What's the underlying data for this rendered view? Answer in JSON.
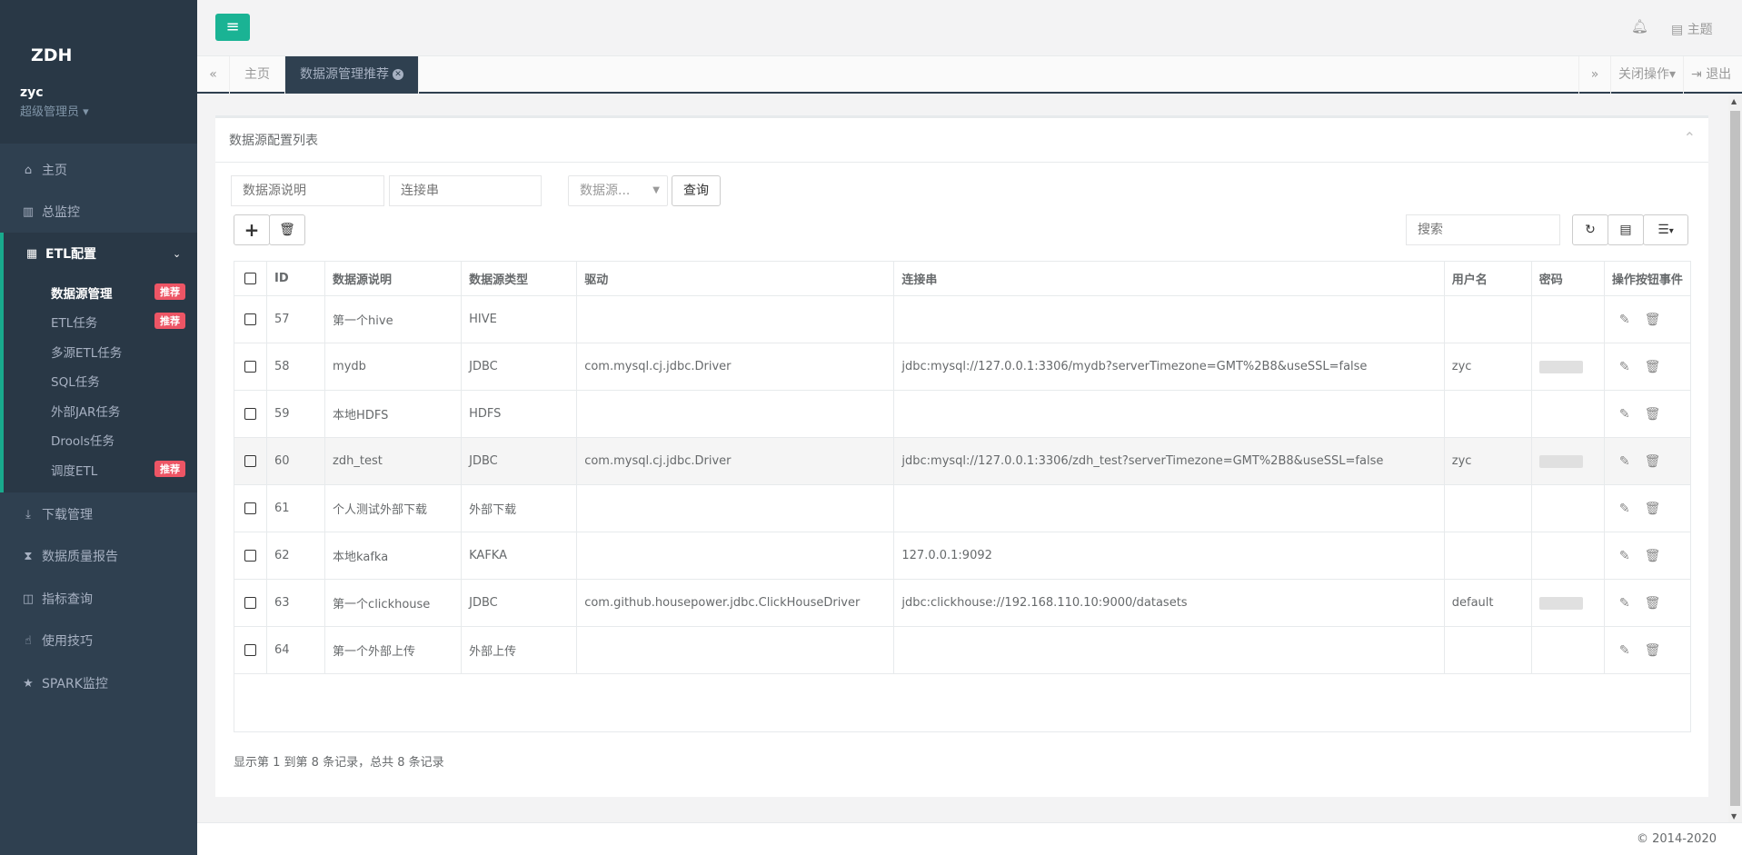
{
  "sidebar": {
    "logo": "ZDH",
    "user": "zyc",
    "role": "超级管理员",
    "nav": {
      "home": "主页",
      "monitor": "总监控",
      "etl": "ETL配置",
      "download": "下载管理",
      "quality": "数据质量报告",
      "metrics": "指标查询",
      "tips": "使用技巧",
      "spark": "SPARK监控"
    },
    "sub": [
      "数据源管理",
      "ETL任务",
      "多源ETL任务",
      "SQL任务",
      "外部JAR任务",
      "Drools任务",
      "调度ETL"
    ],
    "badge": "推荐"
  },
  "topbar": {
    "theme": "主题"
  },
  "tabs": {
    "home": "主页",
    "active": "数据源管理推荐",
    "close_ops": "关闭操作",
    "logout": "退出"
  },
  "panel": {
    "title": "数据源配置列表",
    "filter_desc_placeholder": "数据源说明",
    "filter_url_placeholder": "连接串",
    "filter_type": "数据源...",
    "query_btn": "查询",
    "search_placeholder": "搜索"
  },
  "table": {
    "headers": [
      "ID",
      "数据源说明",
      "数据源类型",
      "驱动",
      "连接串",
      "用户名",
      "密码",
      "操作按钮事件"
    ],
    "rows": [
      {
        "id": "57",
        "desc": "第一个hive",
        "type": "HIVE",
        "driver": "",
        "url": "",
        "user": ""
      },
      {
        "id": "58",
        "desc": "mydb",
        "type": "JDBC",
        "driver": "com.mysql.cj.jdbc.Driver",
        "url": "jdbc:mysql://127.0.0.1:3306/mydb?serverTimezone=GMT%2B8&useSSL=false",
        "user": "zyc"
      },
      {
        "id": "59",
        "desc": "本地HDFS",
        "type": "HDFS",
        "driver": "",
        "url": "",
        "user": ""
      },
      {
        "id": "60",
        "desc": "zdh_test",
        "type": "JDBC",
        "driver": "com.mysql.cj.jdbc.Driver",
        "url": "jdbc:mysql://127.0.0.1:3306/zdh_test?serverTimezone=GMT%2B8&useSSL=false",
        "user": "zyc"
      },
      {
        "id": "61",
        "desc": "个人测试外部下载",
        "type": "外部下载",
        "driver": "",
        "url": "",
        "user": ""
      },
      {
        "id": "62",
        "desc": "本地kafka",
        "type": "KAFKA",
        "driver": "",
        "url": "127.0.0.1:9092",
        "user": ""
      },
      {
        "id": "63",
        "desc": "第一个clickhouse",
        "type": "JDBC",
        "driver": "com.github.housepower.jdbc.ClickHouseDriver",
        "url": "jdbc:clickhouse://192.168.110.10:9000/datasets",
        "user": "default"
      },
      {
        "id": "64",
        "desc": "第一个外部上传",
        "type": "外部上传",
        "driver": "",
        "url": "",
        "user": ""
      }
    ]
  },
  "pagination": {
    "info": "显示第 1 到第 8 条记录，总共 8 条记录"
  },
  "footer": {
    "copyright": "© 2014-2020"
  },
  "colors": {
    "sidebar": "#2f4050",
    "accent": "#1ab394",
    "badge": "#ed5565"
  }
}
